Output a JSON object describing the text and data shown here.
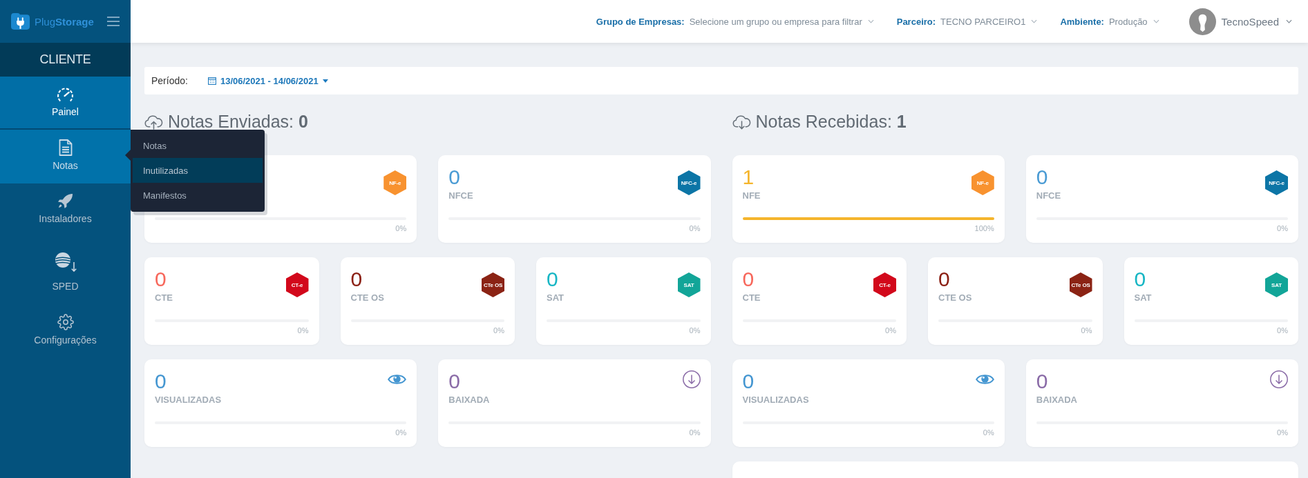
{
  "sidebar": {
    "logo": "Plug**Storage**",
    "section": "CLIENTE",
    "items": [
      {
        "label": "Painel",
        "selected": true,
        "expanded": false
      },
      {
        "label": "Notas",
        "selected": false,
        "expanded": true,
        "submenu": [
          {
            "label": "Notas",
            "selected": false
          },
          {
            "label": "Inutilizadas",
            "selected": true
          },
          {
            "label": "Manifestos",
            "selected": false
          }
        ]
      },
      {
        "label": "Instaladores",
        "selected": false,
        "expanded": false
      },
      {
        "label": "SPED",
        "selected": false,
        "expanded": false
      },
      {
        "label": "Configurações",
        "selected": false,
        "expanded": false
      }
    ]
  },
  "header": {
    "filters": [
      {
        "label": "Grupo de Empresas:",
        "value": "Selecione um grupo ou empresa para filtrar"
      },
      {
        "label": "Parceiro:",
        "value": "TECNO PARCEIRO1"
      },
      {
        "label": "Ambiente:",
        "value": "Produção"
      }
    ],
    "user": {
      "name": "TecnoSpeed"
    }
  },
  "period": {
    "label": "Período:",
    "value": "13/06/2021 - 14/06/2021"
  },
  "sections": [
    {
      "kind": "sent",
      "title": "Notas Enviadas: **0**",
      "rows": [
        [
          {
            "kind": "badge",
            "badge": {
              "text": "NF-e",
              "color": "#f8922f"
            },
            "level": 0,
            "percent": "0%"
          },
          {
            "kind": "badge",
            "value": "0",
            "label": "NFCE",
            "color": "#4a9bd4",
            "badge": {
              "text": "NFC-e",
              "color": "#0c75a6"
            },
            "level": 0,
            "percent": "0%"
          }
        ],
        [
          {
            "kind": "badge",
            "value": "0",
            "label": "CTE",
            "color": "#f7675b",
            "badge": {
              "text": "CT-e",
              "color": "#d2081b"
            },
            "level": 0,
            "percent": "0%"
          },
          {
            "kind": "badge",
            "value": "0",
            "label": "CTE OS",
            "color": "#8b2014",
            "badge": {
              "text": "CTe OS",
              "color": "#8b2314"
            },
            "level": 0,
            "percent": "0%"
          },
          {
            "kind": "badge",
            "value": "0",
            "label": "SAT",
            "color": "#17b6c4",
            "badge": {
              "text": "SAT",
              "color": "#12a598"
            },
            "level": 0,
            "percent": "0%"
          }
        ],
        [
          {
            "kind": "eye",
            "value": "0",
            "label": "VISUALIZADAS",
            "color": "#4496d1",
            "level": 0,
            "percent": "0%"
          },
          {
            "kind": "download",
            "value": "0",
            "label": "BAIXADA",
            "color": "#8a6ba7",
            "level": 0,
            "percent": "0%"
          }
        ]
      ]
    },
    {
      "kind": "received",
      "title": "Notas Recebidas: **1**",
      "rows": [
        [
          {
            "kind": "badge",
            "value": "1",
            "label": "NFE",
            "color": "#f5b52c",
            "badge": {
              "text": "NF-e",
              "color": "#f8922f"
            },
            "level": 1,
            "percent": "100%"
          },
          {
            "kind": "badge",
            "value": "0",
            "label": "NFCE",
            "color": "#4a9bd4",
            "badge": {
              "text": "NFC-e",
              "color": "#0c75a6"
            },
            "level": 0,
            "percent": "0%"
          }
        ],
        [
          {
            "kind": "badge",
            "value": "0",
            "label": "CTE",
            "color": "#f7675b",
            "badge": {
              "text": "CT-e",
              "color": "#d2081b"
            },
            "level": 0,
            "percent": "0%"
          },
          {
            "kind": "badge",
            "value": "0",
            "label": "CTE OS",
            "color": "#8b2014",
            "badge": {
              "text": "CTe OS",
              "color": "#8b2314"
            },
            "level": 0,
            "percent": "0%"
          },
          {
            "kind": "badge",
            "value": "0",
            "label": "SAT",
            "color": "#17b6c4",
            "badge": {
              "text": "SAT",
              "color": "#12a598"
            },
            "level": 0,
            "percent": "0%"
          }
        ],
        [
          {
            "kind": "eye",
            "value": "0",
            "label": "VISUALIZADAS",
            "color": "#4496d1",
            "level": 0,
            "percent": "0%"
          },
          {
            "kind": "download",
            "value": "0",
            "label": "BAIXADA",
            "color": "#8a6ba7",
            "level": 0,
            "percent": "0%"
          }
        ],
        [
          {
            "kind": "blank"
          }
        ]
      ]
    }
  ]
}
